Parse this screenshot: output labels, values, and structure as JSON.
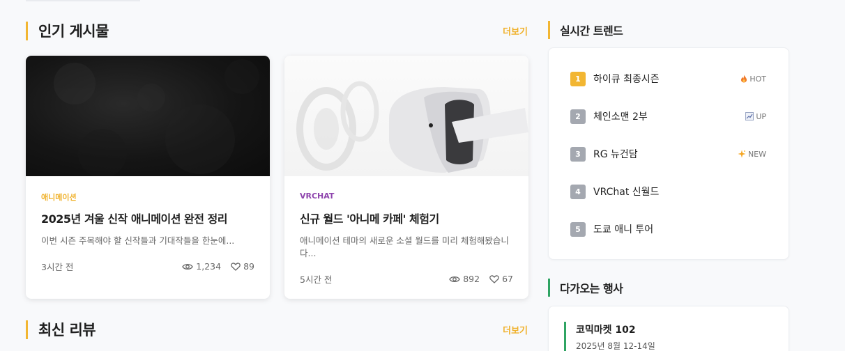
{
  "popular": {
    "title": "인기 게시물",
    "more_label": "더보기",
    "posts": [
      {
        "category": "애니메이션",
        "category_color": "#f0b12a",
        "title": "2025년 겨울 신작 애니메이션 완전 정리",
        "excerpt": "이번 시즌 주목해야 할 신작들과 기대작들을 한눈에...",
        "time": "3시간 전",
        "views": "1,234",
        "likes": "89"
      },
      {
        "category": "VRCHAT",
        "category_color": "#8e44ad",
        "title": "신규 월드 '아니메 카페' 체험기",
        "excerpt": "애니메이션 테마의 새로운 소셜 월드를 미리 체험해봤습니다...",
        "time": "5시간 전",
        "views": "892",
        "likes": "67"
      }
    ]
  },
  "reviews": {
    "title": "최신 리뷰",
    "more_label": "더보기"
  },
  "trends": {
    "title": "실시간 트렌드",
    "accent": "#f2b632",
    "items": [
      {
        "rank": "1",
        "name": "하이큐 최종시즌",
        "tag": "HOT",
        "tag_icon": "fire-icon",
        "rank_color": "#f2b632"
      },
      {
        "rank": "2",
        "name": "체인소맨 2부",
        "tag": "UP",
        "tag_icon": "chart-icon",
        "rank_color": "#a4a8b0"
      },
      {
        "rank": "3",
        "name": "RG 뉴건담",
        "tag": "NEW",
        "tag_icon": "sparkle-icon",
        "rank_color": "#a4a8b0"
      },
      {
        "rank": "4",
        "name": "VRChat 신월드",
        "tag": "",
        "tag_icon": "",
        "rank_color": "#a4a8b0"
      },
      {
        "rank": "5",
        "name": "도쿄 애니 투어",
        "tag": "",
        "tag_icon": "",
        "rank_color": "#a4a8b0"
      }
    ]
  },
  "events": {
    "title": "다가오는 행사",
    "accent": "#2fa463",
    "items": [
      {
        "name": "코믹마켓 102",
        "date": "2025년 8월 12-14일"
      }
    ]
  }
}
